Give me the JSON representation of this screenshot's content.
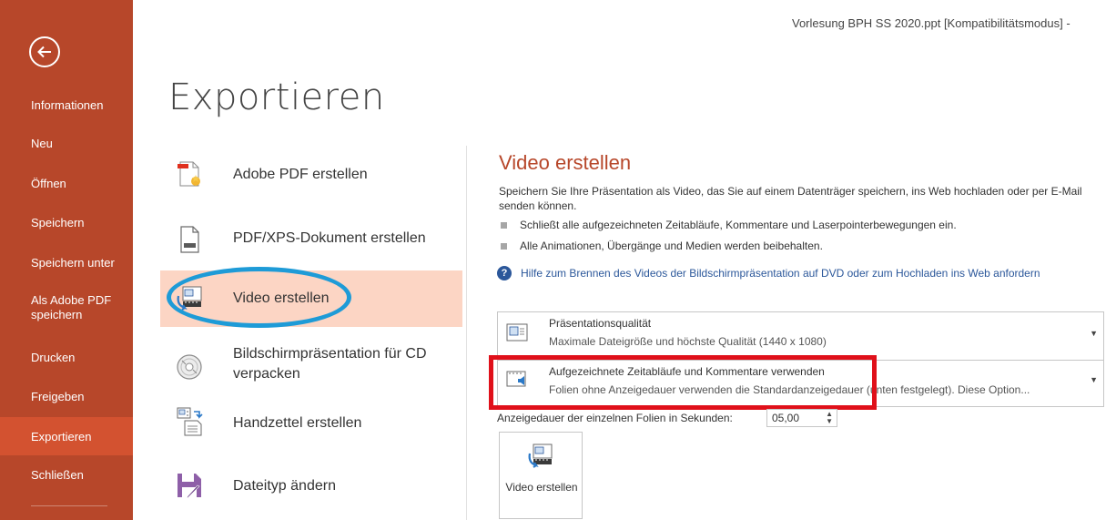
{
  "window": {
    "title": "Vorlesung BPH SS 2020.ppt [Kompatibilitätsmodus] -"
  },
  "sidebar": {
    "items": [
      {
        "label": "Informationen"
      },
      {
        "label": "Neu"
      },
      {
        "label": "Öffnen"
      },
      {
        "label": "Speichern"
      },
      {
        "label": "Speichern unter"
      },
      {
        "label": "Als Adobe PDF speichern"
      },
      {
        "label": "Drucken"
      },
      {
        "label": "Freigeben"
      },
      {
        "label": "Exportieren"
      },
      {
        "label": "Schließen"
      }
    ],
    "active": "Exportieren"
  },
  "page": {
    "title": "Exportieren"
  },
  "export_options": [
    {
      "label": "Adobe PDF erstellen",
      "icon": "adobe-pdf-icon"
    },
    {
      "label": "PDF/XPS-Dokument erstellen",
      "icon": "pdf-xps-document-icon"
    },
    {
      "label": "Video erstellen",
      "icon": "video-icon"
    },
    {
      "label": "Bildschirmpräsentation für CD verpacken",
      "icon": "cd-package-icon"
    },
    {
      "label": "Handzettel erstellen",
      "icon": "handout-icon"
    },
    {
      "label": "Dateityp ändern",
      "icon": "change-filetype-icon"
    }
  ],
  "video_section": {
    "title": "Video erstellen",
    "description": "Speichern Sie Ihre Präsentation als Video, das Sie auf einem Datenträger speichern, ins Web hochladen oder per E-Mail senden können.",
    "bullets": [
      "Schließt alle aufgezeichneten Zeitabläufe, Kommentare und Laserpointerbewegungen ein.",
      "Alle Animationen, Übergänge und Medien werden beibehalten."
    ],
    "help_link": "Hilfe zum Brennen des Videos der Bildschirmpräsentation auf DVD oder zum Hochladen ins Web anfordern",
    "quality_dropdown": {
      "title": "Präsentationsqualität",
      "subtitle": "Maximale Dateigröße und höchste Qualität (1440 x 1080)"
    },
    "timing_dropdown": {
      "title": "Aufgezeichnete Zeitabläufe und Kommentare verwenden",
      "subtitle": "Folien ohne Anzeigedauer verwenden die Standardanzeigedauer (unten festgelegt). Diese Option..."
    },
    "duration_label": "Anzeigedauer der einzelnen Folien in Sekunden:",
    "duration_value": "05,00",
    "create_button_label": "Video erstellen"
  },
  "colors": {
    "sidebar": "#b7472a",
    "sidebar_active": "#d35230",
    "selected_item": "#fcd5c4",
    "accent_title": "#b7472a",
    "link": "#2b579a",
    "annotation_blue": "#1e9bd7",
    "annotation_red": "#e0101a"
  }
}
